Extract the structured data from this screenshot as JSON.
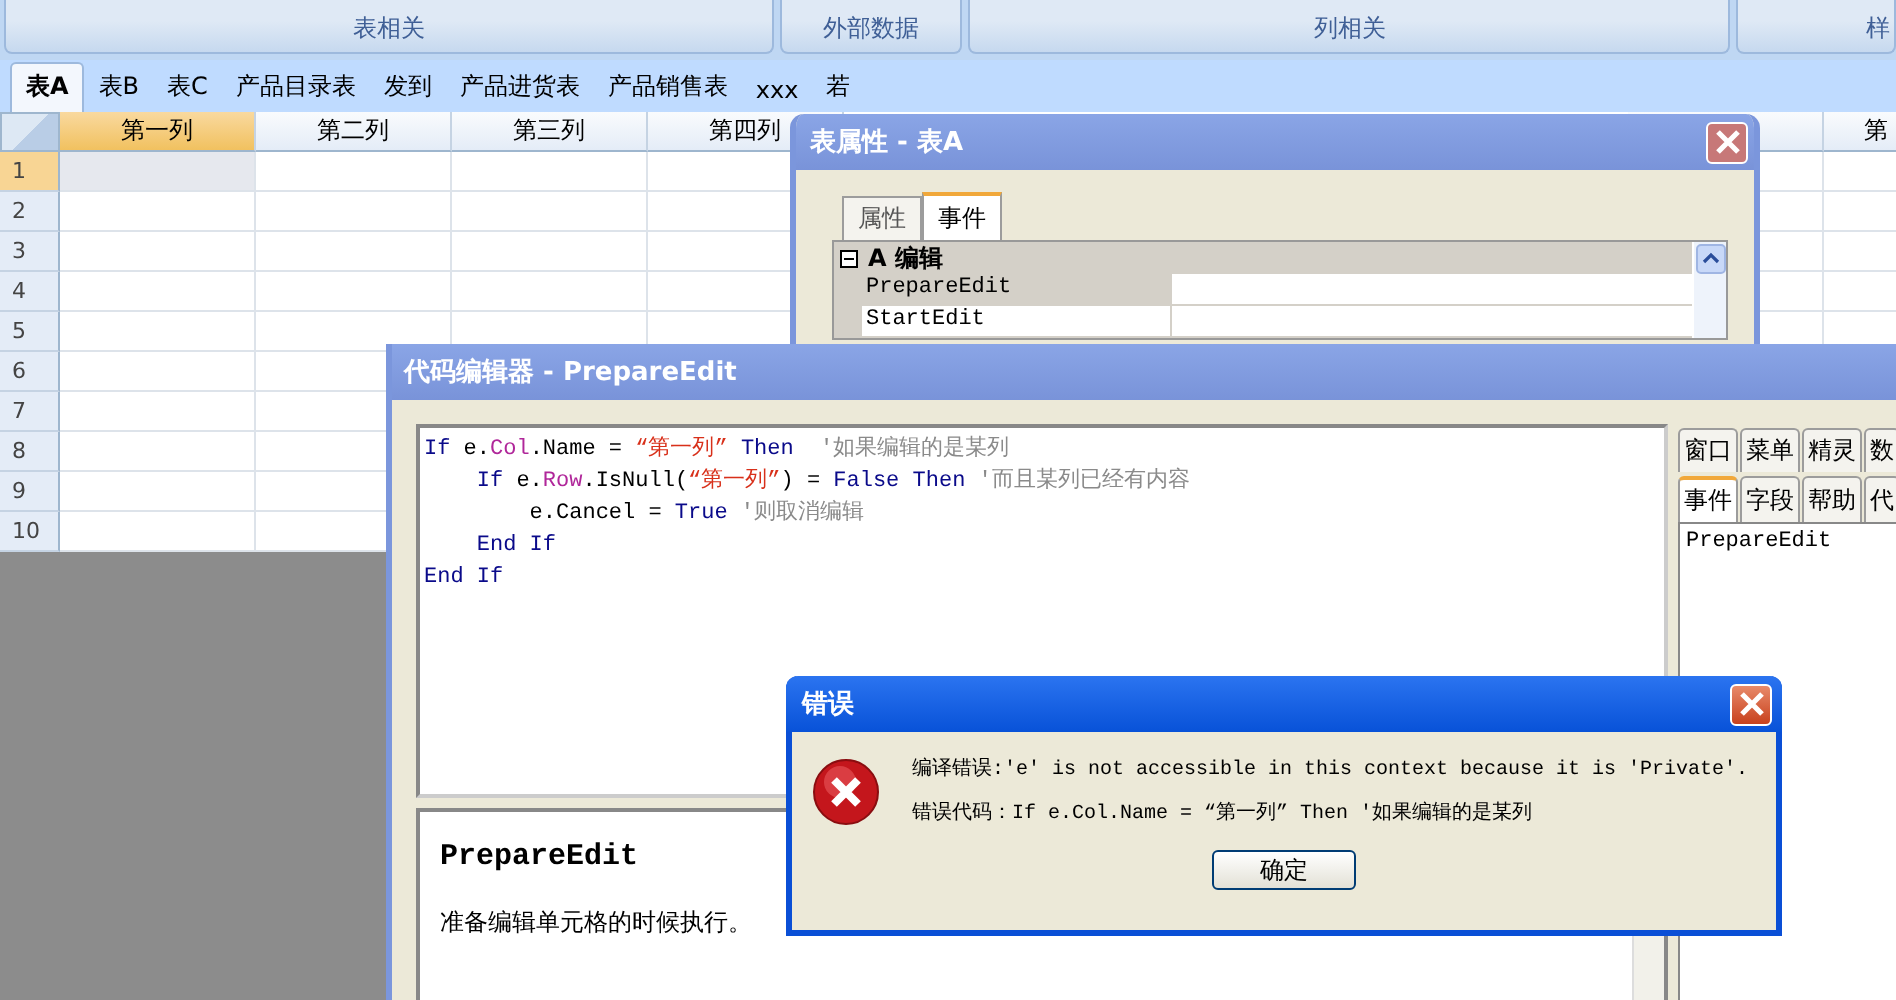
{
  "ribbon": {
    "groups": [
      {
        "label": "表相关"
      },
      {
        "label": "外部数据"
      },
      {
        "label": "列相关"
      },
      {
        "label": "样"
      }
    ]
  },
  "sheet_tabs": [
    {
      "label": "表A",
      "selected": true
    },
    {
      "label": "表B",
      "selected": false
    },
    {
      "label": "表C",
      "selected": false
    },
    {
      "label": "产品目录表",
      "selected": false
    },
    {
      "label": "发到",
      "selected": false
    },
    {
      "label": "产品进货表",
      "selected": false
    },
    {
      "label": "产品销售表",
      "selected": false
    },
    {
      "label": "xxx",
      "selected": false
    },
    {
      "label": "若",
      "selected": false
    }
  ],
  "grid": {
    "columns": [
      {
        "label": "第一列",
        "selected": true
      },
      {
        "label": "第二列",
        "selected": false
      },
      {
        "label": "第三列",
        "selected": false
      },
      {
        "label": "第四列",
        "selected": false
      },
      {
        "label": "第",
        "selected": false
      }
    ],
    "rows": [
      {
        "label": "1",
        "selected": true
      },
      {
        "label": "2",
        "selected": false
      },
      {
        "label": "3",
        "selected": false
      },
      {
        "label": "4",
        "selected": false
      },
      {
        "label": "5",
        "selected": false
      },
      {
        "label": "6",
        "selected": false
      },
      {
        "label": "7",
        "selected": false
      },
      {
        "label": "8",
        "selected": false
      },
      {
        "label": "9",
        "selected": false
      },
      {
        "label": "10",
        "selected": false
      }
    ]
  },
  "table_properties_dialog": {
    "title": "表属性 - 表A",
    "tabs": [
      {
        "label": "属性",
        "selected": false
      },
      {
        "label": "事件",
        "selected": true
      }
    ],
    "category": {
      "label": "A 编辑",
      "expanded": true
    },
    "events": [
      {
        "name": "PrepareEdit",
        "selected": false
      },
      {
        "name": "StartEdit",
        "selected": true
      }
    ]
  },
  "code_editor": {
    "title": "代码编辑器 - PrepareEdit",
    "code_lines": [
      [
        {
          "kind": "keyword",
          "text": "If"
        },
        {
          "kind": "plain",
          "text": " e."
        },
        {
          "kind": "member",
          "text": "Col"
        },
        {
          "kind": "plain",
          "text": ".Name = "
        },
        {
          "kind": "string",
          "text": "“第一列”"
        },
        {
          "kind": "keyword",
          "text": " Then"
        },
        {
          "kind": "comment",
          "text": "  '如果编辑的是某列"
        }
      ],
      [
        {
          "kind": "keyword",
          "text": "    If"
        },
        {
          "kind": "plain",
          "text": " e."
        },
        {
          "kind": "member",
          "text": "Row"
        },
        {
          "kind": "plain",
          "text": ".IsNull("
        },
        {
          "kind": "string",
          "text": "“第一列”"
        },
        {
          "kind": "plain",
          "text": ") = "
        },
        {
          "kind": "keyword",
          "text": "False Then"
        },
        {
          "kind": "comment",
          "text": " '而且某列已经有内容"
        }
      ],
      [
        {
          "kind": "plain",
          "text": "        e.Cancel = "
        },
        {
          "kind": "keyword",
          "text": "True"
        },
        {
          "kind": "comment",
          "text": " '则取消编辑"
        }
      ],
      [
        {
          "kind": "keyword",
          "text": "    End If"
        }
      ],
      [
        {
          "kind": "keyword",
          "text": "End If"
        }
      ]
    ],
    "help": {
      "heading": "PrepareEdit",
      "description": "准备编辑单元格的时候执行。"
    },
    "side_tabs_row_1": [
      {
        "label": "窗口",
        "selected": false
      },
      {
        "label": "菜单",
        "selected": false
      },
      {
        "label": "精灵",
        "selected": false
      },
      {
        "label": "数",
        "selected": false
      }
    ],
    "side_tabs_row_2": [
      {
        "label": "事件",
        "selected": true
      },
      {
        "label": "字段",
        "selected": false
      },
      {
        "label": "帮助",
        "selected": false
      },
      {
        "label": "代",
        "selected": false
      }
    ],
    "side_list": [
      "PrepareEdit"
    ]
  },
  "error_dialog": {
    "title": "错误",
    "message": "编译错误:'e' is not accessible in this context because it is 'Private'.",
    "code_line": "错误代码：If e.Col.Name = “第一列” Then  '如果编辑的是某列",
    "button": "确定"
  }
}
